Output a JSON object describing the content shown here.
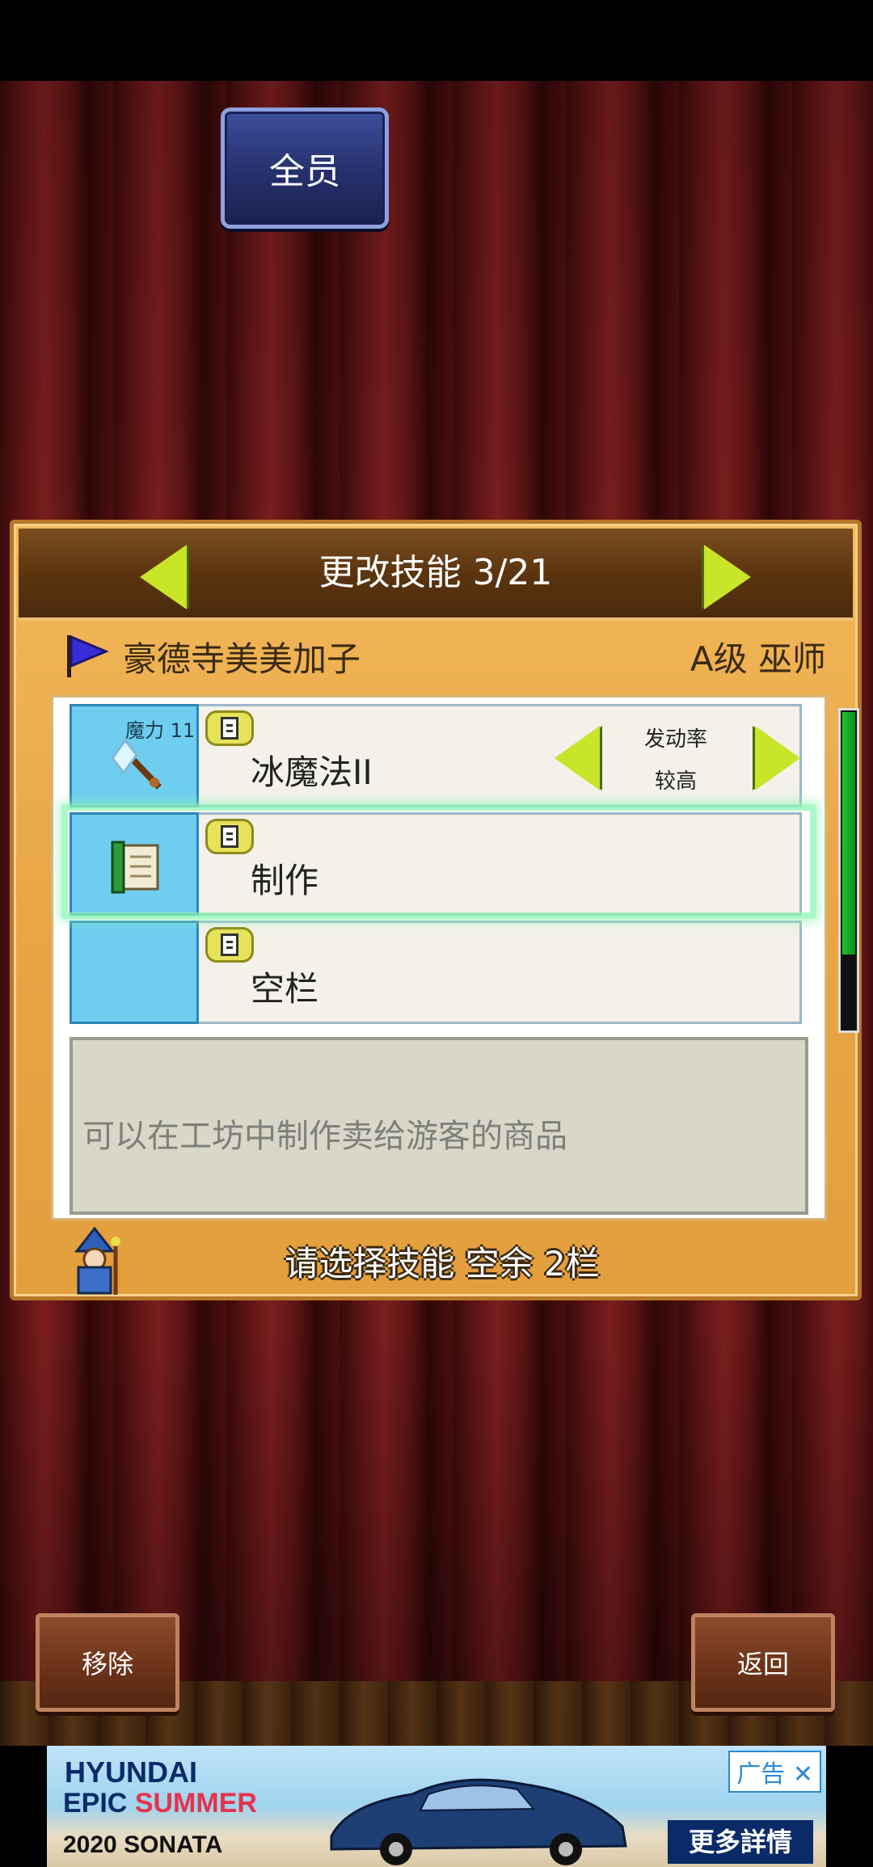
{
  "top_button": {
    "label": "全员"
  },
  "panel": {
    "title": "更改技能 3/21",
    "character": {
      "name": "豪德寺美美加子",
      "class": "A级 巫师"
    },
    "skills": [
      {
        "name": "冰魔法II",
        "mp_label": "魔力 11",
        "rate_title": "发动率",
        "rate_value": "较高",
        "icon": "ice-staff-icon"
      },
      {
        "name": "制作",
        "icon": "scroll-icon"
      },
      {
        "name": "空栏",
        "icon": "empty-slot"
      }
    ],
    "description": "可以在工坊中制作卖给游客的商品",
    "footer": "请选择技能 空余 2栏",
    "scroll_position": 0.75
  },
  "buttons": {
    "remove": "移除",
    "back": "返回"
  },
  "ad": {
    "brand": "HYUNDAI",
    "line1a": "EPIC ",
    "line1b": "SUMMER",
    "line2": "2020 SONATA",
    "tag": "广告",
    "cta": "更多詳情"
  },
  "colors": {
    "accent_arrow": "#c9e52a",
    "panel_wood": "#e9a645",
    "skill_icon_bg": "#6fcdef"
  }
}
